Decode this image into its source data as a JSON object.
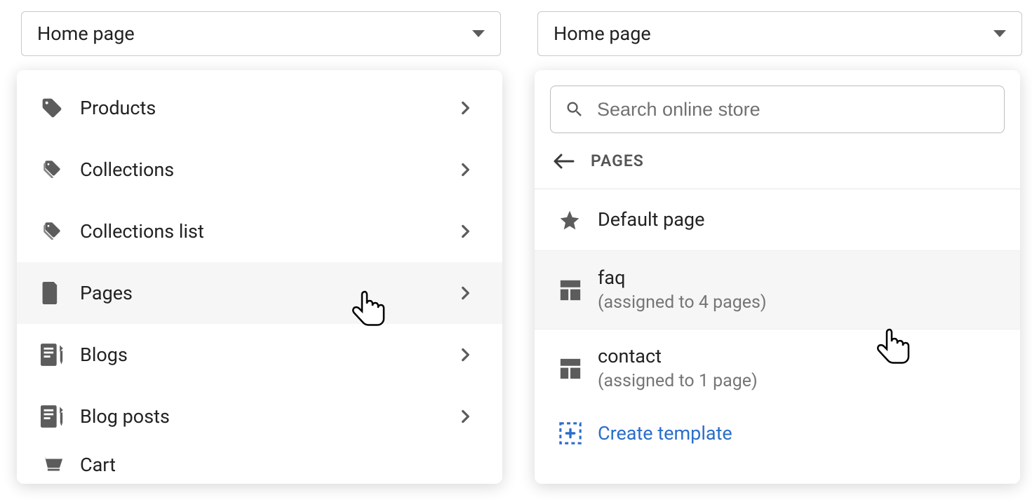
{
  "left": {
    "dropdown": {
      "label": "Home page"
    },
    "menu": {
      "products": "Products",
      "collections": "Collections",
      "collections_list": "Collections list",
      "pages": "Pages",
      "blogs": "Blogs",
      "blog_posts": "Blog posts",
      "cart": "Cart"
    }
  },
  "right": {
    "dropdown": {
      "label": "Home page"
    },
    "search": {
      "placeholder": "Search online store"
    },
    "back_title": "PAGES",
    "default_page": "Default page",
    "faq": {
      "title": "faq",
      "sub": "(assigned to 4 pages)"
    },
    "contact": {
      "title": "contact",
      "sub": "(assigned to 1 page)"
    },
    "create_label": "Create template"
  }
}
